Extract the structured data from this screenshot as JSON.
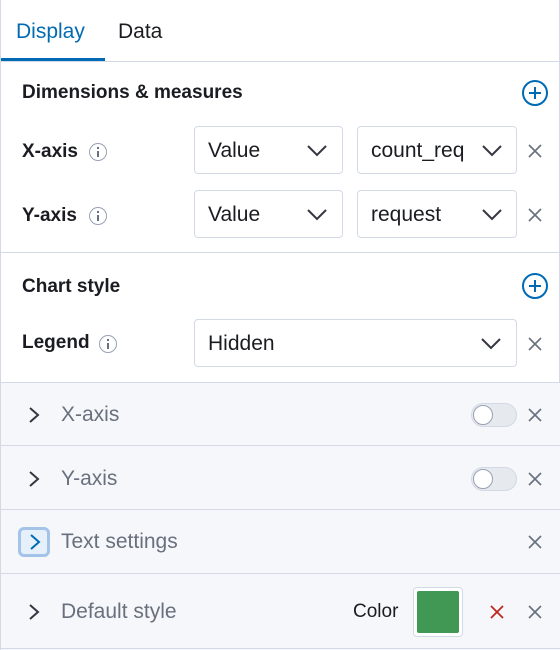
{
  "tabs": [
    {
      "label": "Display",
      "active": true
    },
    {
      "label": "Data",
      "active": false
    }
  ],
  "dimensions": {
    "title": "Dimensions & measures",
    "x_axis": {
      "label": "X-axis",
      "type": "Value",
      "field": "count_req"
    },
    "y_axis": {
      "label": "Y-axis",
      "type": "Value",
      "field": "request"
    }
  },
  "chart_style": {
    "title": "Chart style",
    "legend": {
      "label": "Legend",
      "value": "Hidden"
    }
  },
  "accordions": [
    {
      "label": "X-axis",
      "toggle": false
    },
    {
      "label": "Y-axis",
      "toggle": false
    },
    {
      "label": "Text settings"
    },
    {
      "label": "Default style"
    }
  ],
  "default_style": {
    "color_label": "Color",
    "color": "#409854"
  },
  "colors": {
    "accent": "#006bb4",
    "danger": "#bd271e"
  }
}
